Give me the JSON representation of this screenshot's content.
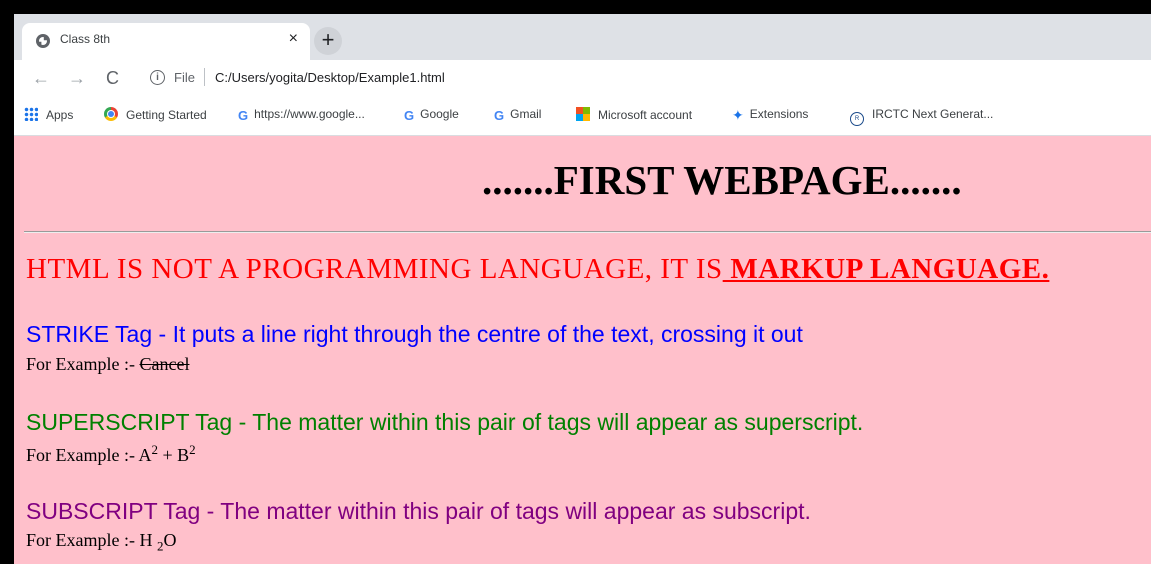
{
  "tab": {
    "title": "Class 8th",
    "close": "×"
  },
  "new_tab": "+",
  "toolbar": {
    "back": "←",
    "forward": "→",
    "reload": "C",
    "info": "i",
    "scheme": "File",
    "url": "C:/Users/yogita/Desktop/Example1.html"
  },
  "bookmarks": [
    {
      "label": "Apps",
      "icon": "apps-grid-icon"
    },
    {
      "label": "Getting Started",
      "icon": "chrome-icon"
    },
    {
      "label": "https://www.google...",
      "icon": "google-icon"
    },
    {
      "label": "Google",
      "icon": "google-icon"
    },
    {
      "label": "Gmail",
      "icon": "google-icon"
    },
    {
      "label": "Microsoft account",
      "icon": "microsoft-icon"
    },
    {
      "label": "Extensions",
      "icon": "puzzle-icon"
    },
    {
      "label": "IRCTC Next Generat...",
      "icon": "irctc-icon"
    }
  ],
  "page": {
    "heading": ".......FIRST WEBPAGE.......",
    "markup_text": "HTML IS NOT A PROGRAMMING LANGUAGE, IT IS",
    "markup_underlined": " MARKUP LANGUAGE.",
    "strike": {
      "desc": "STRIKE Tag - It puts a line right through the centre of the text, crossing it out",
      "example_prefix": "For Example :- ",
      "example_value": "Cancel",
      "color": "#0000ff"
    },
    "superscript": {
      "desc": "SUPERSCRIPT Tag - The matter within this pair of tags will appear as superscript.",
      "example_prefix": "For Example :- ",
      "a": "A",
      "a_sup": "2",
      "plus": " + ",
      "b": "B",
      "b_sup": "2",
      "color": "#008000"
    },
    "subscript": {
      "desc": "SUBSCRIPT Tag - The matter within this pair of tags will appear as subscript.",
      "example_prefix": "For Example :- ",
      "h": "H ",
      "h_sub": "2",
      "o": "O",
      "color": "#800080"
    }
  },
  "colors": {
    "page_background": "#ffc0cb",
    "markup_text": "#ff0000"
  }
}
